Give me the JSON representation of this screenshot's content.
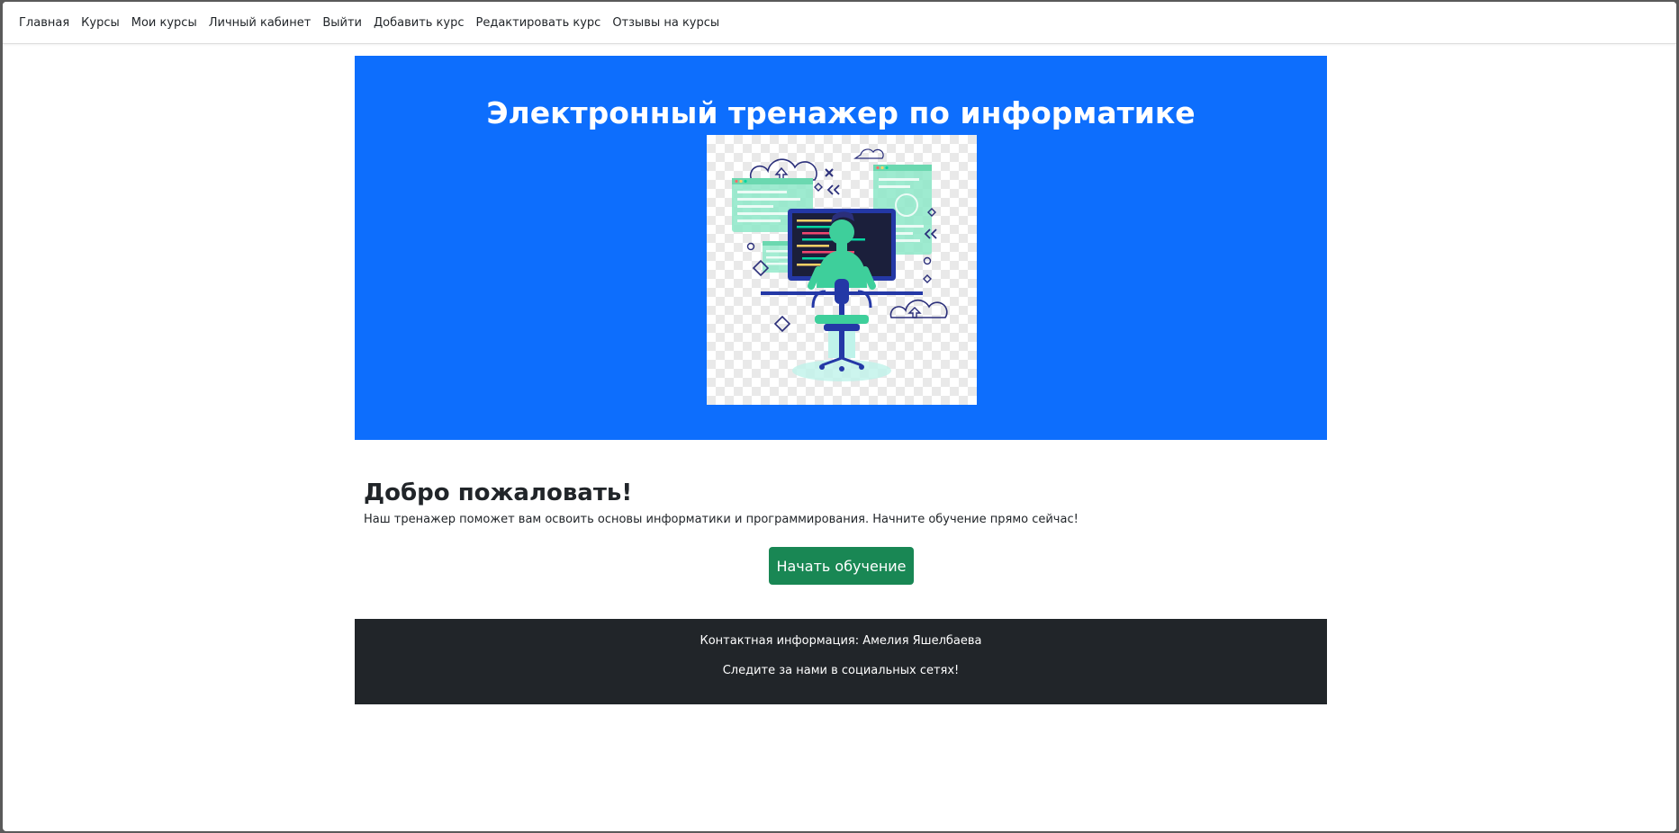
{
  "nav": {
    "items": [
      {
        "label": "Главная"
      },
      {
        "label": "Курсы"
      },
      {
        "label": "Мои курсы"
      },
      {
        "label": "Личный кабинет"
      },
      {
        "label": "Выйти"
      },
      {
        "label": "Добавить курс"
      },
      {
        "label": "Редактировать курс"
      },
      {
        "label": "Отзывы на курсы"
      }
    ]
  },
  "hero": {
    "title": "Электронный тренажер по информатике",
    "image_icon": "programmer-at-computer-illustration",
    "background_color": "#0d6efd"
  },
  "welcome": {
    "title": "Добро пожаловать!",
    "text": "Наш тренажер поможет вам освоить основы информатики и программирования. Начните обучение прямо сейчас!",
    "button_label": "Начать обучение",
    "button_color": "#198754"
  },
  "footer": {
    "contact": "Контактная информация: Амелия Яшелбаева",
    "social": "Следите за нами в социальных сетях!",
    "background_color": "#212529"
  }
}
